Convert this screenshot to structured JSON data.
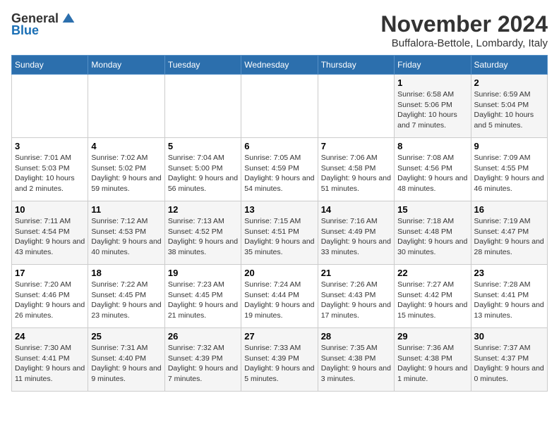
{
  "logo": {
    "general": "General",
    "blue": "Blue"
  },
  "header": {
    "month_title": "November 2024",
    "location": "Buffalora-Bettole, Lombardy, Italy"
  },
  "columns": [
    "Sunday",
    "Monday",
    "Tuesday",
    "Wednesday",
    "Thursday",
    "Friday",
    "Saturday"
  ],
  "weeks": [
    [
      {
        "day": "",
        "info": ""
      },
      {
        "day": "",
        "info": ""
      },
      {
        "day": "",
        "info": ""
      },
      {
        "day": "",
        "info": ""
      },
      {
        "day": "",
        "info": ""
      },
      {
        "day": "1",
        "info": "Sunrise: 6:58 AM\nSunset: 5:06 PM\nDaylight: 10 hours and 7 minutes."
      },
      {
        "day": "2",
        "info": "Sunrise: 6:59 AM\nSunset: 5:04 PM\nDaylight: 10 hours and 5 minutes."
      }
    ],
    [
      {
        "day": "3",
        "info": "Sunrise: 7:01 AM\nSunset: 5:03 PM\nDaylight: 10 hours and 2 minutes."
      },
      {
        "day": "4",
        "info": "Sunrise: 7:02 AM\nSunset: 5:02 PM\nDaylight: 9 hours and 59 minutes."
      },
      {
        "day": "5",
        "info": "Sunrise: 7:04 AM\nSunset: 5:00 PM\nDaylight: 9 hours and 56 minutes."
      },
      {
        "day": "6",
        "info": "Sunrise: 7:05 AM\nSunset: 4:59 PM\nDaylight: 9 hours and 54 minutes."
      },
      {
        "day": "7",
        "info": "Sunrise: 7:06 AM\nSunset: 4:58 PM\nDaylight: 9 hours and 51 minutes."
      },
      {
        "day": "8",
        "info": "Sunrise: 7:08 AM\nSunset: 4:56 PM\nDaylight: 9 hours and 48 minutes."
      },
      {
        "day": "9",
        "info": "Sunrise: 7:09 AM\nSunset: 4:55 PM\nDaylight: 9 hours and 46 minutes."
      }
    ],
    [
      {
        "day": "10",
        "info": "Sunrise: 7:11 AM\nSunset: 4:54 PM\nDaylight: 9 hours and 43 minutes."
      },
      {
        "day": "11",
        "info": "Sunrise: 7:12 AM\nSunset: 4:53 PM\nDaylight: 9 hours and 40 minutes."
      },
      {
        "day": "12",
        "info": "Sunrise: 7:13 AM\nSunset: 4:52 PM\nDaylight: 9 hours and 38 minutes."
      },
      {
        "day": "13",
        "info": "Sunrise: 7:15 AM\nSunset: 4:51 PM\nDaylight: 9 hours and 35 minutes."
      },
      {
        "day": "14",
        "info": "Sunrise: 7:16 AM\nSunset: 4:49 PM\nDaylight: 9 hours and 33 minutes."
      },
      {
        "day": "15",
        "info": "Sunrise: 7:18 AM\nSunset: 4:48 PM\nDaylight: 9 hours and 30 minutes."
      },
      {
        "day": "16",
        "info": "Sunrise: 7:19 AM\nSunset: 4:47 PM\nDaylight: 9 hours and 28 minutes."
      }
    ],
    [
      {
        "day": "17",
        "info": "Sunrise: 7:20 AM\nSunset: 4:46 PM\nDaylight: 9 hours and 26 minutes."
      },
      {
        "day": "18",
        "info": "Sunrise: 7:22 AM\nSunset: 4:45 PM\nDaylight: 9 hours and 23 minutes."
      },
      {
        "day": "19",
        "info": "Sunrise: 7:23 AM\nSunset: 4:45 PM\nDaylight: 9 hours and 21 minutes."
      },
      {
        "day": "20",
        "info": "Sunrise: 7:24 AM\nSunset: 4:44 PM\nDaylight: 9 hours and 19 minutes."
      },
      {
        "day": "21",
        "info": "Sunrise: 7:26 AM\nSunset: 4:43 PM\nDaylight: 9 hours and 17 minutes."
      },
      {
        "day": "22",
        "info": "Sunrise: 7:27 AM\nSunset: 4:42 PM\nDaylight: 9 hours and 15 minutes."
      },
      {
        "day": "23",
        "info": "Sunrise: 7:28 AM\nSunset: 4:41 PM\nDaylight: 9 hours and 13 minutes."
      }
    ],
    [
      {
        "day": "24",
        "info": "Sunrise: 7:30 AM\nSunset: 4:41 PM\nDaylight: 9 hours and 11 minutes."
      },
      {
        "day": "25",
        "info": "Sunrise: 7:31 AM\nSunset: 4:40 PM\nDaylight: 9 hours and 9 minutes."
      },
      {
        "day": "26",
        "info": "Sunrise: 7:32 AM\nSunset: 4:39 PM\nDaylight: 9 hours and 7 minutes."
      },
      {
        "day": "27",
        "info": "Sunrise: 7:33 AM\nSunset: 4:39 PM\nDaylight: 9 hours and 5 minutes."
      },
      {
        "day": "28",
        "info": "Sunrise: 7:35 AM\nSunset: 4:38 PM\nDaylight: 9 hours and 3 minutes."
      },
      {
        "day": "29",
        "info": "Sunrise: 7:36 AM\nSunset: 4:38 PM\nDaylight: 9 hours and 1 minute."
      },
      {
        "day": "30",
        "info": "Sunrise: 7:37 AM\nSunset: 4:37 PM\nDaylight: 9 hours and 0 minutes."
      }
    ]
  ]
}
